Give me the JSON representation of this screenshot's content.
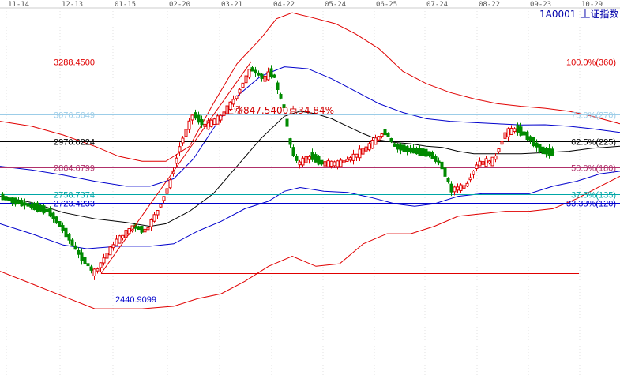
{
  "chart_data": {
    "type": "candlestick",
    "instrument": {
      "code": "1A0001",
      "name": "上证指数"
    },
    "date_labels": [
      "11-14",
      "12-13",
      "01-15",
      "02-20",
      "03-21",
      "04-22",
      "05-24",
      "06-25",
      "07-24",
      "08-22",
      "09-23",
      "10-29"
    ],
    "ylim": [
      2035,
      3535
    ],
    "gold_levels": [
      {
        "value": 3288.45,
        "label_left": "3288.4500",
        "label_right": "100.0%(360)",
        "color": "#e00000"
      },
      {
        "value": 3076.5649,
        "label_left": "3076.5649",
        "label_right": "75.0%(270)",
        "color": "#9ccde8"
      },
      {
        "value": 2970.6224,
        "label_left": "2970.6224",
        "label_right": "62.5%(225)",
        "color": "#000000"
      },
      {
        "value": 2864.6799,
        "label_left": "2864.6799",
        "label_right": "50.0%(180)",
        "color": "#b0306a"
      },
      {
        "value": 2758.7374,
        "label_left": "2758.7374",
        "label_right": "37.5%(135)",
        "color": "#00a6a6"
      },
      {
        "value": 2723.4233,
        "label_left": "2723.4233",
        "label_right": "33.33%(120)",
        "color": "#0000cc"
      },
      {
        "value": 2440.9099,
        "label_left": "",
        "label_right": "",
        "color": "#e00000"
      }
    ],
    "low_label": "2440.9099",
    "rise_annotation": "上涨847.5400点34.84%",
    "series": [
      {
        "name": "upper-band",
        "color": "#e00000"
      },
      {
        "name": "lower-band",
        "color": "#e00000"
      },
      {
        "name": "upper-envelope",
        "color": "#0000cc"
      },
      {
        "name": "lower-envelope",
        "color": "#0000cc"
      },
      {
        "name": "moving-average",
        "color": "#000000"
      }
    ],
    "colors": {
      "up": "#e00000",
      "down": "#008a00",
      "grid": "#e0e0e0"
    }
  }
}
